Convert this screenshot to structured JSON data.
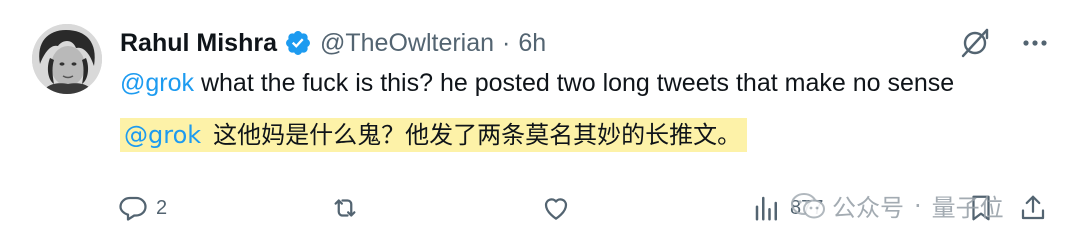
{
  "user": {
    "display_name": "Rahul Mishra",
    "handle": "@TheOwlterian",
    "separator": "·",
    "time": "6h"
  },
  "tweet": {
    "mention": "@grok",
    "text": " what the fuck is this? he posted two long tweets that make no sense"
  },
  "translation": {
    "mention": "@grok",
    "text": "这他妈是什么鬼？他发了两条莫名其妙的长推文。"
  },
  "actions": {
    "reply_count": "2",
    "retweet_count": "",
    "like_count": "",
    "views_count": "877"
  },
  "watermark": {
    "text": "公众号",
    "separator": "·",
    "name": "量子位"
  },
  "colors": {
    "accent": "#1d9bf0",
    "secondary_text": "#536471",
    "highlight": "#fdf2a8"
  },
  "icons": [
    "verified-badge-icon",
    "grok-icon",
    "more-icon",
    "reply-icon",
    "retweet-icon",
    "like-icon",
    "views-icon",
    "bookmark-icon",
    "share-icon",
    "wechat-logo-icon"
  ]
}
